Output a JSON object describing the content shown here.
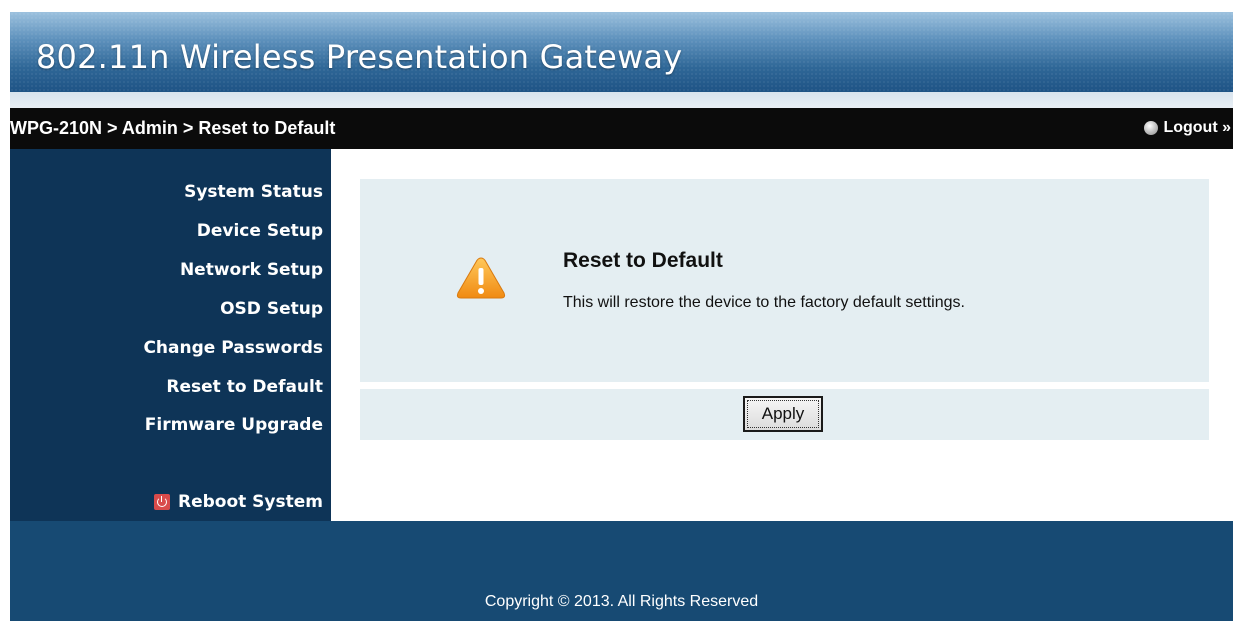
{
  "header": {
    "title": "802.11n Wireless Presentation Gateway"
  },
  "breadcrumb": {
    "text": "WPG-210N > Admin > Reset to Default"
  },
  "logout": {
    "label": "Logout »",
    "icon": "logout-icon"
  },
  "sidebar": {
    "items": [
      {
        "label": "System Status"
      },
      {
        "label": "Device Setup"
      },
      {
        "label": "Network Setup"
      },
      {
        "label": "OSD Setup"
      },
      {
        "label": "Change Passwords"
      },
      {
        "label": "Reset to Default"
      },
      {
        "label": "Firmware Upgrade"
      }
    ],
    "reboot": {
      "label": "Reboot System",
      "icon": "power-icon"
    }
  },
  "main": {
    "heading": "Reset to Default",
    "description": "This will restore the device to the factory default settings.",
    "icon": "warning-icon",
    "apply_label": "Apply"
  },
  "footer": {
    "copyright": "Copyright © 2013. All Rights Reserved"
  },
  "colors": {
    "banner": "#2f6797",
    "breadcrumb_bar": "#0b0b0b",
    "sidebar": "#0e3457",
    "panel": "#e4eef2",
    "footer": "#174a73",
    "warning": "#f5a623"
  }
}
